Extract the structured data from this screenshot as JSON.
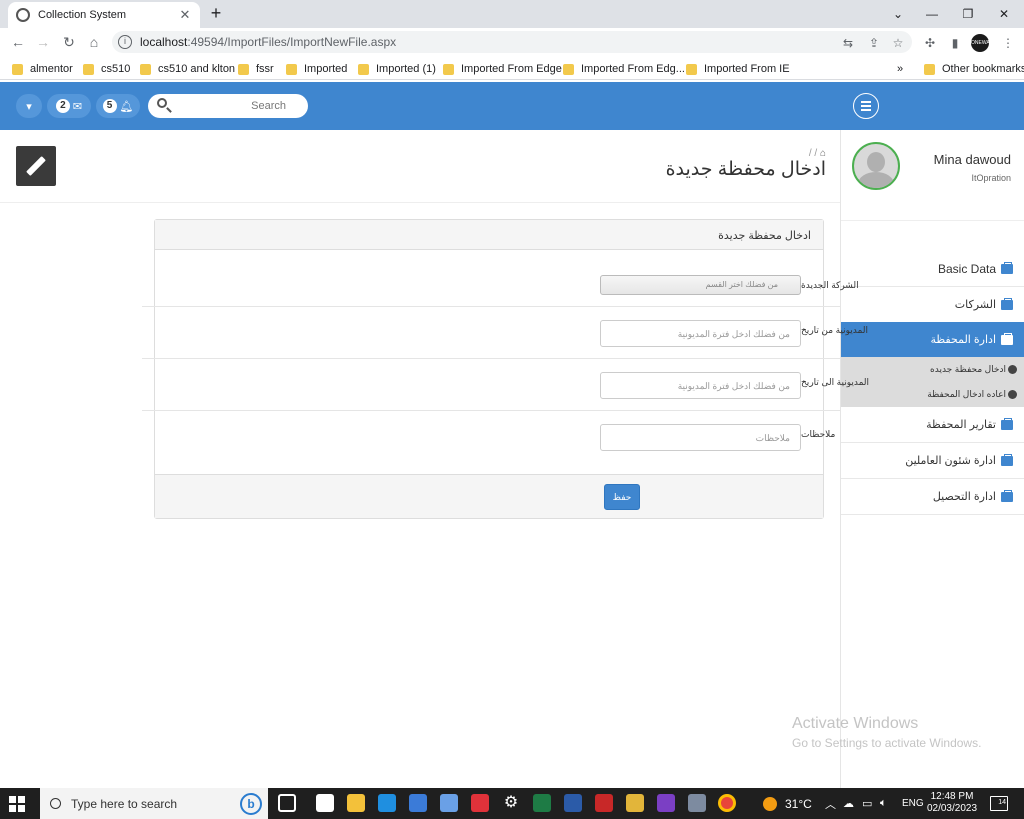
{
  "browser": {
    "tab_title": "Collection System",
    "url_host": "localhost",
    "url_rest": ":49594/ImportFiles/ImportNewFile.aspx",
    "bookmarks": [
      "almentor",
      "cs510",
      "cs510 and klton",
      "fssr",
      "Imported",
      "Imported (1)",
      "Imported From Edge",
      "Imported From Edg...",
      "Imported From IE"
    ],
    "other_bookmarks": "Other bookmarks",
    "overflow": "»",
    "profile_label": "ONEWA"
  },
  "header": {
    "messages_count": "2",
    "notifications_count": "5",
    "search_placeholder": "Search"
  },
  "user": {
    "name": "Mina dawoud",
    "role": "ItOpration"
  },
  "sidebar": {
    "items": [
      {
        "label": "Basic Data"
      },
      {
        "label": "الشركات"
      },
      {
        "label": "ادارة المحفظة"
      },
      {
        "label": "تقارير المحفظة"
      },
      {
        "label": "ادارة شئون العاملين"
      },
      {
        "label": "ادارة التحصيل"
      }
    ],
    "subitems": [
      {
        "label": "ادخال محفظة جديده"
      },
      {
        "label": "اعاده ادخال المحفظة"
      }
    ]
  },
  "page": {
    "breadcrumb": "/ /",
    "title": "ادخال محفظة جديدة"
  },
  "form": {
    "panel_title": "ادخال محفظة جديدة",
    "company_label": "الشركة الجديدة",
    "company_placeholder": "من فضلك اختر القسم",
    "from_date_label": "المديونية من تاريخ",
    "from_date_placeholder": "من فضلك ادخل فترة المديونية",
    "to_date_label": "المديونية الى تاريخ",
    "to_date_placeholder": "من فضلك ادخل فترة المديونية",
    "notes_label": "ملاحظات",
    "notes_placeholder": "ملاحظات",
    "save_label": "حفظ"
  },
  "watermark": {
    "line1": "Activate Windows",
    "line2": "Go to Settings to activate Windows."
  },
  "taskbar": {
    "search_text": "Type here to search",
    "temperature": "31°C",
    "language": "ENG",
    "time": "12:48 PM",
    "date": "02/03/2023",
    "notif_count": "14"
  },
  "colors": {
    "accent": "#3f86cf",
    "sidebar_active": "#3f86cf"
  }
}
